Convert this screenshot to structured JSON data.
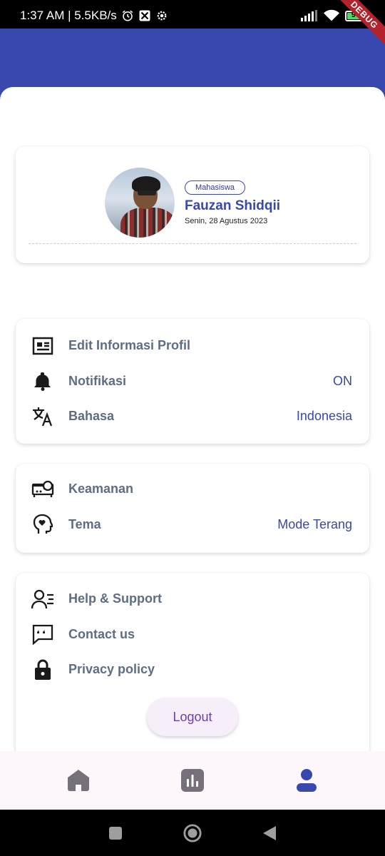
{
  "status_bar": {
    "time_speed": "1:37 AM | 5.5KB/s",
    "battery_level": "90",
    "debug_label": "DEBUG"
  },
  "profile": {
    "role": "Mahasiswa",
    "name": "Fauzan Shidqii",
    "date": "Senin, 28 Agustus 2023"
  },
  "menu_group_1": [
    {
      "icon": "profile-card-icon",
      "label": "Edit Informasi Profil",
      "value": ""
    },
    {
      "icon": "bell-icon",
      "label": "Notifikasi",
      "value": "ON"
    },
    {
      "icon": "translate-icon",
      "label": "Bahasa",
      "value": "Indonesia"
    }
  ],
  "menu_group_2": [
    {
      "icon": "security-icon",
      "label": "Keamanan",
      "value": ""
    },
    {
      "icon": "theme-head-icon",
      "label": "Tema",
      "value": "Mode Terang"
    }
  ],
  "menu_group_3": [
    {
      "icon": "support-icon",
      "label": "Help & Support",
      "value": ""
    },
    {
      "icon": "chat-quote-icon",
      "label": "Contact us",
      "value": ""
    },
    {
      "icon": "lock-icon",
      "label": "Privacy policy",
      "value": ""
    }
  ],
  "logout_label": "Logout",
  "bottom_nav": [
    "home-icon",
    "chart-icon",
    "person-icon"
  ],
  "colors": {
    "primary": "#3848ad",
    "label_gray": "#5d6e84",
    "nav_inactive": "#76707a"
  }
}
